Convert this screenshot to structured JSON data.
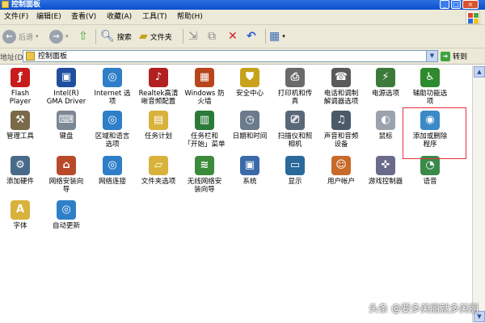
{
  "window": {
    "title": "控制面板",
    "buttons": [
      "_",
      "□",
      "×"
    ]
  },
  "menu": {
    "items": [
      "文件(F)",
      "编辑(E)",
      "查看(V)",
      "收藏(A)",
      "工具(T)",
      "帮助(H)"
    ]
  },
  "toolbar": {
    "back_label": "后退",
    "forward_label": "",
    "search_label": "搜索",
    "folders_label": "文件夹"
  },
  "address": {
    "label": "地址(D)",
    "value": "控制面板",
    "go_label": "转到"
  },
  "items": [
    {
      "label": "Flash\nPlayer",
      "icon": "flash-icon",
      "color": "#c71c1c",
      "glyph": "ƒ"
    },
    {
      "label": "Intel(R)\nGMA Driver",
      "icon": "monitor-icon",
      "color": "#1f4f9e",
      "glyph": "▣"
    },
    {
      "label": "Internet 选\n项",
      "icon": "globe-icon",
      "color": "#2f7fc8",
      "glyph": "◎"
    },
    {
      "label": "Realtek高清\n晰音频配置",
      "icon": "speaker-icon",
      "color": "#b22020",
      "glyph": "♪"
    },
    {
      "label": "Windows 防\n火墙",
      "icon": "firewall-icon",
      "color": "#b8451c",
      "glyph": "▦"
    },
    {
      "label": "安全中心",
      "icon": "shield-icon",
      "color": "#c7a21a",
      "glyph": "⛊"
    },
    {
      "label": "打印机和传\n真",
      "icon": "printer-icon",
      "color": "#6a6a6a",
      "glyph": "⎙"
    },
    {
      "label": "电话和调制\n解调器选项",
      "icon": "phone-icon",
      "color": "#5a5a5a",
      "glyph": "☎"
    },
    {
      "label": "电源选项",
      "icon": "power-icon",
      "color": "#3c7a3c",
      "glyph": "⚡"
    },
    {
      "label": "辅助功能选\n项",
      "icon": "accessibility-icon",
      "color": "#2e8a2e",
      "glyph": "♿"
    },
    {
      "label": "管理工具",
      "icon": "admin-tools-icon",
      "color": "#7a6a4a",
      "glyph": "⚒"
    },
    {
      "label": "键盘",
      "icon": "keyboard-icon",
      "color": "#7c8794",
      "glyph": "⌨"
    },
    {
      "label": "区域和语言\n选项",
      "icon": "region-globe-icon",
      "color": "#2f7fc8",
      "glyph": "◎"
    },
    {
      "label": "任务计划",
      "icon": "task-folder-icon",
      "color": "#d8b23a",
      "glyph": "▤"
    },
    {
      "label": "任务栏和\n「开始」菜单",
      "icon": "taskbar-icon",
      "color": "#2a7a3a",
      "glyph": "▥"
    },
    {
      "label": "日期和时间",
      "icon": "clock-icon",
      "color": "#6b7a8c",
      "glyph": "◷"
    },
    {
      "label": "扫描仪和照\n相机",
      "icon": "scanner-icon",
      "color": "#5a6878",
      "glyph": "⎚"
    },
    {
      "label": "声音和音频\n设备",
      "icon": "sound-icon",
      "color": "#4a5a6a",
      "glyph": "♫"
    },
    {
      "label": "鼠标",
      "icon": "mouse-icon",
      "color": "#9aa3ad",
      "glyph": "◐"
    },
    {
      "label": "添加或删除\n程序",
      "icon": "add-remove-programs-icon",
      "color": "#3a8ac8",
      "glyph": "◉"
    },
    {
      "label": "添加硬件",
      "icon": "add-hardware-icon",
      "color": "#4a6a8a",
      "glyph": "⚙"
    },
    {
      "label": "网络安装向\n导",
      "icon": "network-home-icon",
      "color": "#b84a2a",
      "glyph": "⌂"
    },
    {
      "label": "网络连接",
      "icon": "network-globe-icon",
      "color": "#2f7fc8",
      "glyph": "◎"
    },
    {
      "label": "文件夹选项",
      "icon": "folder-options-icon",
      "color": "#d8b23a",
      "glyph": "▱"
    },
    {
      "label": "无线网络安\n装向导",
      "icon": "wireless-icon",
      "color": "#3c8a3c",
      "glyph": "≋"
    },
    {
      "label": "系统",
      "icon": "system-icon",
      "color": "#3a6aa8",
      "glyph": "▣"
    },
    {
      "label": "显示",
      "icon": "display-icon",
      "color": "#2a6a9a",
      "glyph": "▭"
    },
    {
      "label": "用户帐户",
      "icon": "users-icon",
      "color": "#c86a2a",
      "glyph": "☺"
    },
    {
      "label": "游戏控制器",
      "icon": "gamepad-icon",
      "color": "#6a6a8a",
      "glyph": "✜"
    },
    {
      "label": "语音",
      "icon": "speech-icon",
      "color": "#3a8a4a",
      "glyph": "◔"
    },
    {
      "label": "字体",
      "icon": "fonts-folder-icon",
      "color": "#d8b23a",
      "glyph": "A"
    },
    {
      "label": "自动更新",
      "icon": "update-globe-icon",
      "color": "#2f7fc8",
      "glyph": "◎"
    }
  ],
  "watermark": "头条 @要多美丽就多美丽"
}
